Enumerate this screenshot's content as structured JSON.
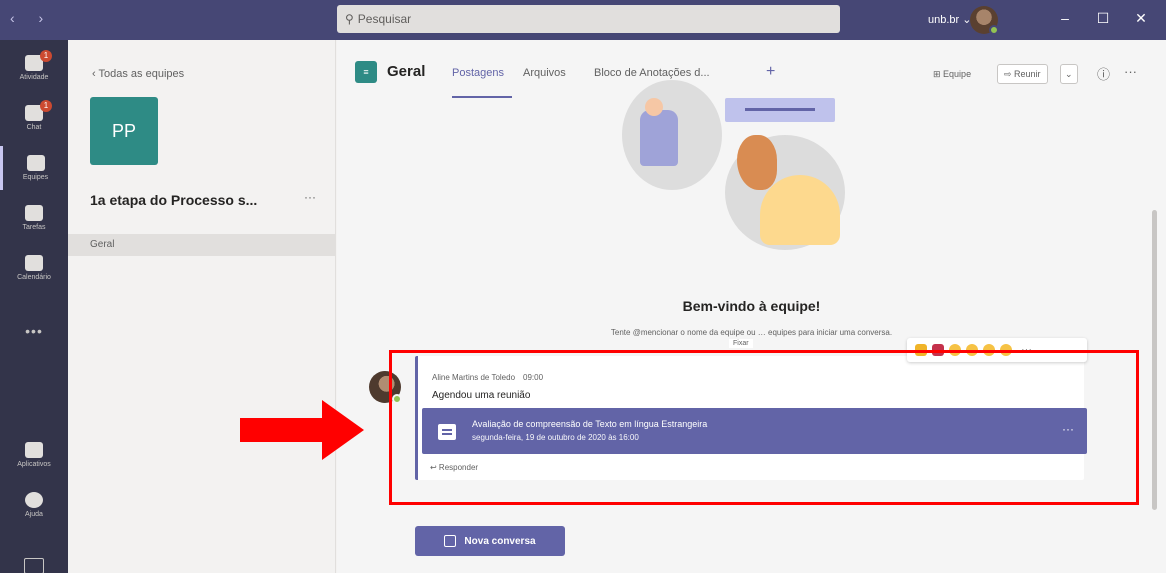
{
  "titlebar": {
    "nav_arrows": "‹ ›",
    "search_placeholder": "Pesquisar",
    "search_icon": "search-icon",
    "tenant": "unb.br",
    "window_buttons": [
      "–",
      "☐",
      "✕"
    ]
  },
  "rail": {
    "items": [
      {
        "label": "Atividade",
        "icon": "bell-icon",
        "badge": "1"
      },
      {
        "label": "Chat",
        "icon": "chat-icon",
        "badge": "1"
      },
      {
        "label": "Equipes",
        "icon": "teams-icon",
        "badge": ""
      },
      {
        "label": "Tarefas",
        "icon": "assignments-icon",
        "badge": ""
      },
      {
        "label": "Calendário",
        "icon": "calendar-icon",
        "badge": ""
      }
    ],
    "more": "•••",
    "bottom_items": [
      {
        "label": "Aplicativos",
        "icon": "apps-icon"
      },
      {
        "label": "Ajuda",
        "icon": "help-icon"
      }
    ]
  },
  "left_pane": {
    "back_label": "‹  Todas as equipes",
    "team_initials": "PP",
    "team_name": "1a etapa do Processo s...",
    "more": "···",
    "channel": "Geral"
  },
  "main": {
    "channel_title": "Geral",
    "tabs": [
      {
        "label": "Postagens",
        "active": true
      },
      {
        "label": "Arquivos",
        "active": false
      },
      {
        "label": "Bloco de Anotações d...",
        "active": false
      }
    ],
    "add_tab": "+",
    "team_button": "Equipe",
    "meet_button": "Reunir",
    "meet_dropdown": "⌄",
    "info_icon": "ⓘ",
    "more": "···",
    "welcome_title": "Bem-vindo à equipe!",
    "welcome_sub": "Tente @mencionar o nome da equipe ou … equipes para iniciar uma conversa.",
    "tooltip": "Fixar",
    "post": {
      "author": "Aline Martins de Toledo",
      "time": "09:00",
      "action": "Agendou uma reunião",
      "meeting_title": "Avaliação de compreensão de Texto em língua Estrangeira",
      "meeting_date": "segunda-feira, 19 de outubro de 2020 às 16:00",
      "meeting_more": "···",
      "reply": "↩ Responder"
    },
    "reaction_more": "···",
    "new_conversation": "Nova conversa"
  },
  "colors": {
    "accent": "#6264a7",
    "titlebar": "#464775",
    "rail": "#33344a",
    "highlight": "#ff0000",
    "team_tile": "#2e8b85"
  }
}
